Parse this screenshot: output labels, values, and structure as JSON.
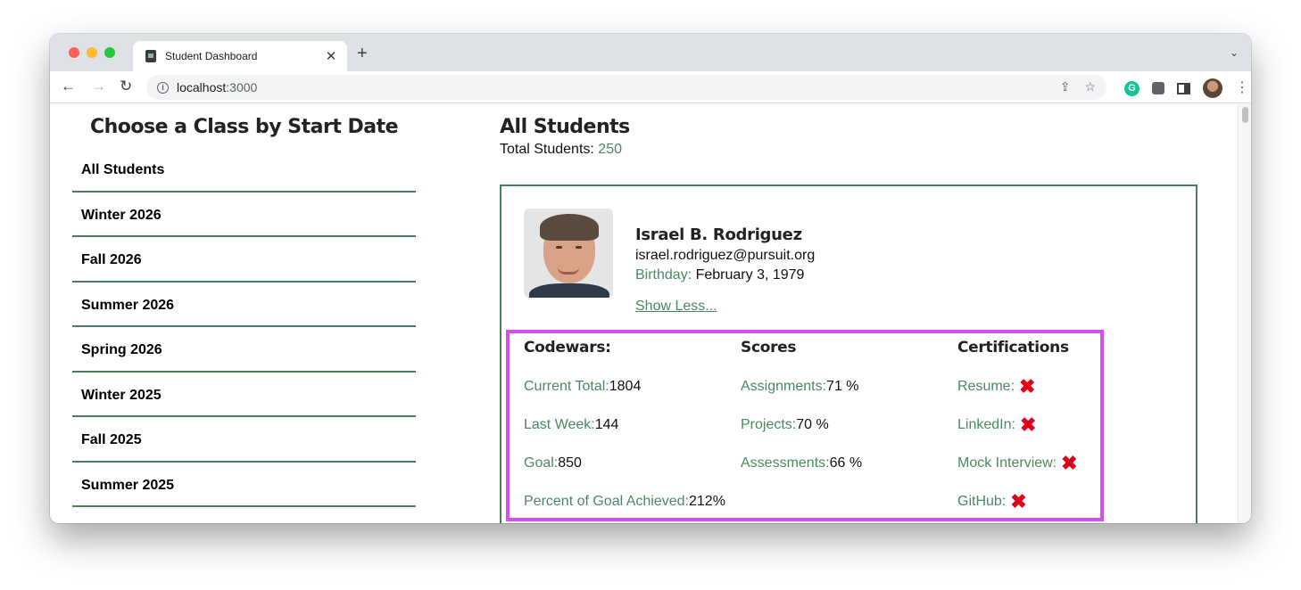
{
  "browser": {
    "tab_title": "Student Dashboard",
    "url_host": "localhost",
    "url_port": ":3000",
    "new_tab_symbol": "+",
    "close_symbol": "✕",
    "icons": {
      "back": "←",
      "forward": "→",
      "reload": "↻",
      "info": "i",
      "share": "⇪",
      "bookmark": "☆",
      "grammarly": "G",
      "menu": "⋮",
      "tab_menu": "⌄"
    }
  },
  "sidebar": {
    "title": "Choose a Class by Start Date",
    "items": [
      {
        "label": "All Students"
      },
      {
        "label": "Winter 2026"
      },
      {
        "label": "Fall 2026"
      },
      {
        "label": "Summer 2026"
      },
      {
        "label": "Spring 2026"
      },
      {
        "label": "Winter 2025"
      },
      {
        "label": "Fall 2025"
      },
      {
        "label": "Summer 2025"
      }
    ]
  },
  "main": {
    "title": "All Students",
    "total_label": "Total Students: ",
    "total_value": "250"
  },
  "student": {
    "name": "Israel B. Rodriguez",
    "email": "israel.rodriguez@pursuit.org",
    "birthday_label": "Birthday: ",
    "birthday_value": "February 3, 1979",
    "toggle_label": "Show Less..."
  },
  "details": {
    "codewars": {
      "heading": "Codewars:",
      "rows": [
        {
          "label": "Current Total: ",
          "value": "1804"
        },
        {
          "label": "Last Week: ",
          "value": "144"
        },
        {
          "label": "Goal: ",
          "value": "850"
        },
        {
          "label": "Percent of Goal Achieved: ",
          "value": "212%"
        }
      ]
    },
    "scores": {
      "heading": "Scores",
      "rows": [
        {
          "label": "Assignments: ",
          "value": "71 %"
        },
        {
          "label": "Projects: ",
          "value": "70 %"
        },
        {
          "label": "Assessments: ",
          "value": "66 %"
        }
      ]
    },
    "certifications": {
      "heading": "Certifications",
      "status_symbol": "✖",
      "rows": [
        {
          "label": "Resume: ",
          "status": "incomplete"
        },
        {
          "label": "LinkedIn: ",
          "status": "incomplete"
        },
        {
          "label": "Mock Interview: ",
          "status": "incomplete"
        },
        {
          "label": "GitHub: ",
          "status": "incomplete"
        }
      ]
    }
  },
  "colors": {
    "accent_green": "#4a7f5e",
    "highlight_magenta": "#d64ef0",
    "incomplete_red": "#e0001b"
  }
}
